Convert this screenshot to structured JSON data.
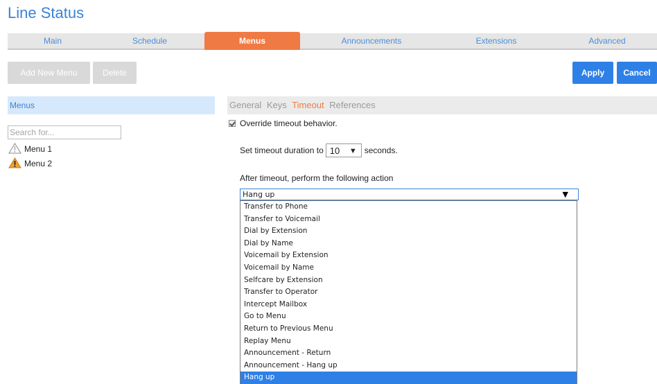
{
  "page": {
    "title": "Line Status"
  },
  "tabs": [
    "Main",
    "Schedule",
    "Menus",
    "Announcements",
    "Extensions",
    "Advanced"
  ],
  "active_tab": "Menus",
  "toolbar": {
    "add_new_menu": "Add New Menu",
    "delete": "Delete",
    "apply": "Apply",
    "cancel": "Cancel"
  },
  "sidebar": {
    "header": "Menus",
    "search_placeholder": "Search for...",
    "items": [
      {
        "label": "Menu 1",
        "icon": "warning-outline-icon"
      },
      {
        "label": "Menu 2",
        "icon": "warning-filled-icon"
      }
    ]
  },
  "subtabs": [
    "General",
    "Keys",
    "Timeout",
    "References"
  ],
  "active_subtab": "Timeout",
  "timeout": {
    "override_label": "Override timeout behavior.",
    "override_checked": true,
    "duration_prefix": "Set timeout duration to",
    "duration_value": "10",
    "duration_suffix": "seconds.",
    "after_label": "After timeout, perform the following action",
    "selected_action": "Hang up",
    "options": [
      "Transfer to Phone",
      "Transfer to Voicemail",
      "Dial by Extension",
      "Dial by Name",
      "Voicemail by Extension",
      "Voicemail by Name",
      "Selfcare by Extension",
      "Transfer to Operator",
      "Intercept Mailbox",
      "Go to Menu",
      "Return to Previous Menu",
      "Replay Menu",
      "Announcement - Return",
      "Announcement - Hang up",
      "Hang up"
    ]
  },
  "colors": {
    "accent_orange": "#f07a43",
    "primary_blue": "#2f80e6",
    "link_blue": "#3a83d4",
    "warning_orange": "#f0a030"
  }
}
